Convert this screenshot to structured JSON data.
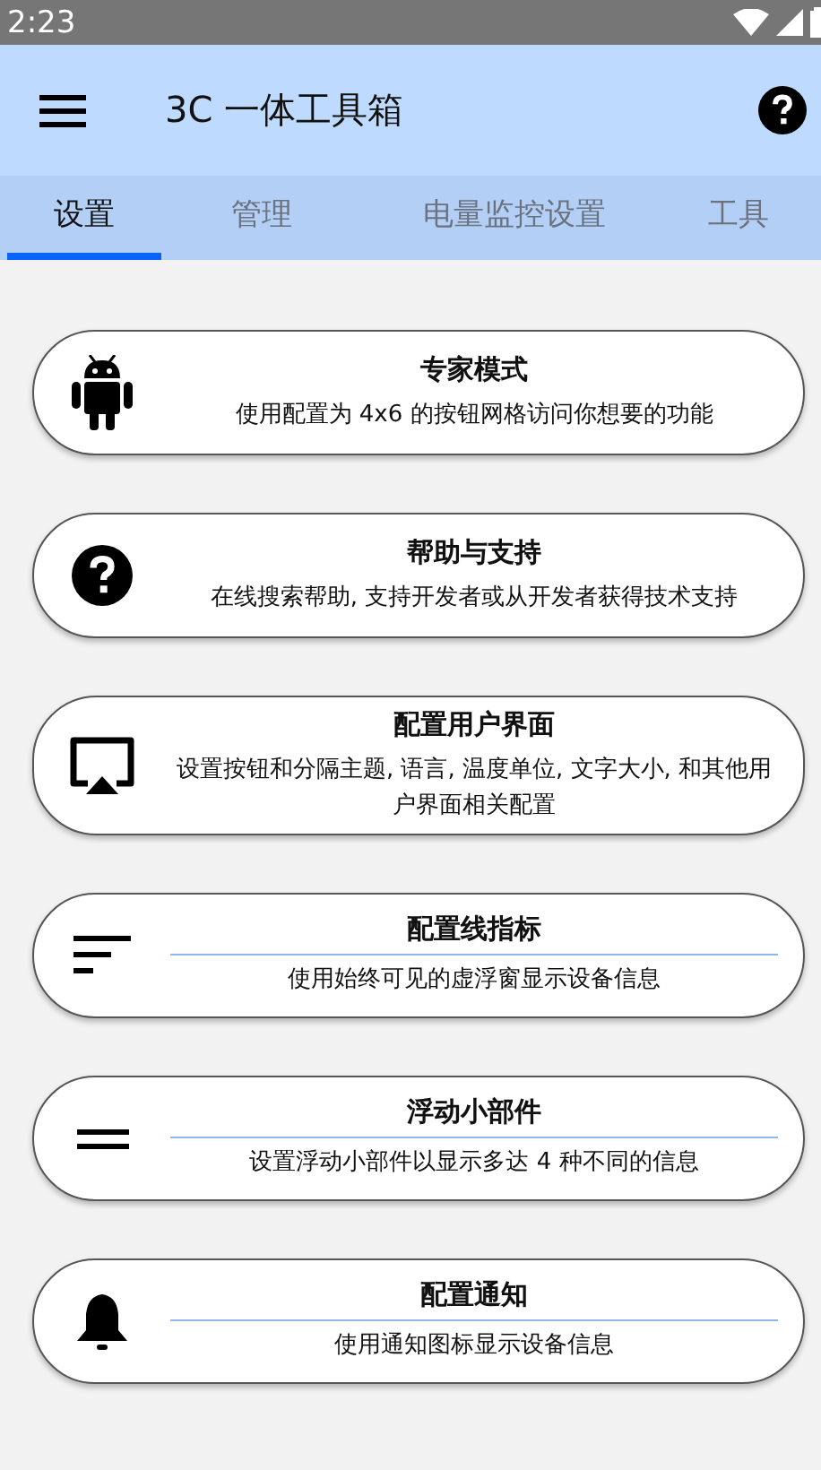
{
  "status_bar": {
    "time": "2:23"
  },
  "app_bar": {
    "title": "3C 一体工具箱"
  },
  "tabs": [
    {
      "label": "设置",
      "selected": true
    },
    {
      "label": "管理",
      "selected": false
    },
    {
      "label": "电量监控设置",
      "selected": false
    },
    {
      "label": "工具",
      "selected": false
    }
  ],
  "cards": [
    {
      "kind": "android",
      "title": "专家模式",
      "subtitle": "使用配置为 4x6 的按钮网格访问你想要的功能",
      "divider": false
    },
    {
      "kind": "help",
      "title": "帮助与支持",
      "subtitle": "在线搜索帮助, 支持开发者或从开发者获得技术支持",
      "divider": false
    },
    {
      "kind": "cast",
      "title": "配置用户界面",
      "subtitle": "设置按钮和分隔主题, 语言, 温度单位, 文字大小, 和其他用户界面相关配置",
      "divider": false
    },
    {
      "kind": "sort",
      "title": "配置线指标",
      "subtitle": "使用始终可见的虚浮窗显示设备信息",
      "divider": true
    },
    {
      "kind": "equals",
      "title": "浮动小部件",
      "subtitle": "设置浮动小部件以显示多达 4 种不同的信息",
      "divider": true
    },
    {
      "kind": "bell",
      "title": "配置通知",
      "subtitle": "使用通知图标显示设备信息",
      "divider": true
    }
  ]
}
